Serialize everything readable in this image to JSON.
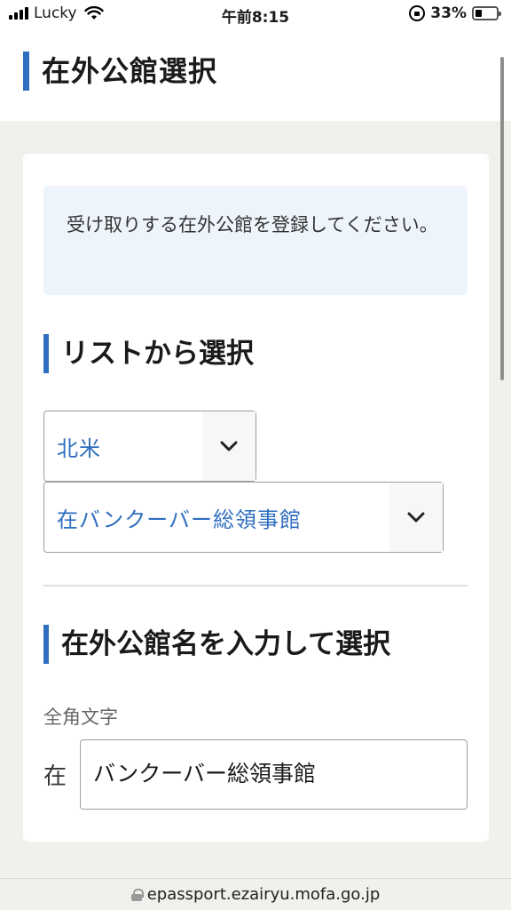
{
  "status_bar": {
    "carrier": "Lucky",
    "time": "午前8:15",
    "battery": "33%",
    "battery_level": 0.33
  },
  "header": {
    "title": "在外公館選択"
  },
  "notice": {
    "text": "受け取りする在外公館を登録してください。"
  },
  "list_section": {
    "heading": "リストから選択",
    "region_select": {
      "value": "北米"
    },
    "office_select": {
      "value": "在バンクーバー総領事館"
    }
  },
  "input_section": {
    "heading": "在外公館名を入力して選択",
    "hint": "全角文字",
    "prefix": "在",
    "input_value": "バンクーバー総領事館"
  },
  "browser": {
    "url": "epassport.ezairyu.mofa.go.jp"
  },
  "colors": {
    "accent": "#2f6ec0",
    "notice_bg": "#eef4fc",
    "page_bg": "#f1f0ec"
  }
}
